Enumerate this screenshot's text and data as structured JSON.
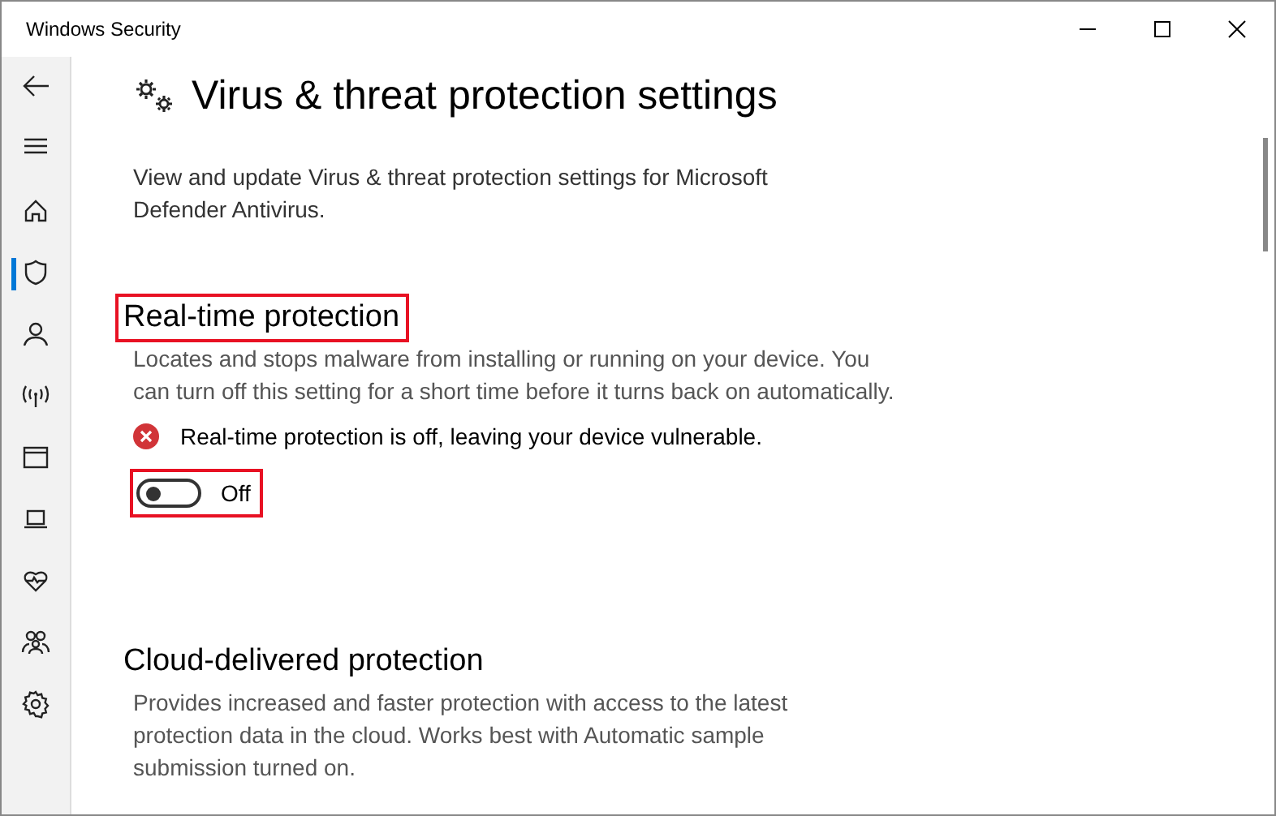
{
  "window": {
    "title": "Windows Security"
  },
  "sidebar": {
    "items": [
      {
        "kind": "back",
        "selected": false
      },
      {
        "kind": "menu",
        "selected": false
      },
      {
        "kind": "home",
        "selected": false
      },
      {
        "kind": "shield",
        "selected": true
      },
      {
        "kind": "person",
        "selected": false
      },
      {
        "kind": "wireless",
        "selected": false
      },
      {
        "kind": "browser",
        "selected": false
      },
      {
        "kind": "laptop",
        "selected": false
      },
      {
        "kind": "heart",
        "selected": false
      },
      {
        "kind": "family",
        "selected": false
      },
      {
        "kind": "settings",
        "selected": false
      }
    ]
  },
  "page": {
    "title": "Virus & threat protection settings",
    "description": "View and update Virus & threat protection settings for Microsoft Defender Antivirus."
  },
  "sections": [
    {
      "heading": "Real-time protection",
      "highlighted": true,
      "description": "Locates and stops malware from installing or running on your device. You can turn off this setting for a short time before it turns back on automatically.",
      "status": {
        "kind": "error",
        "text": "Real-time protection is off, leaving your device vulnerable."
      },
      "toggle": {
        "on": false,
        "label": "Off",
        "highlighted": true
      }
    },
    {
      "heading": "Cloud-delivered protection",
      "highlighted": false,
      "description": "Provides increased and faster protection with access to the latest protection data in the cloud. Works best with Automatic sample submission turned on."
    }
  ]
}
